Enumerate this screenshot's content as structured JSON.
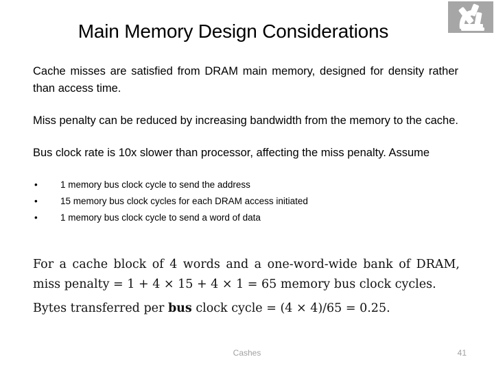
{
  "logo": {
    "icon": "microscope-icon",
    "bg_color": "#a6a6a6",
    "glyph_color": "#ffffff"
  },
  "title": "Main Memory Design Considerations",
  "body": {
    "paragraphs": [
      "Cache misses are satisfied from DRAM main memory, designed for density rather than access time.",
      "Miss penalty can be reduced by increasing bandwidth from the memory to the cache.",
      "Bus clock rate is 10x slower than processor, affecting the miss penalty. Assume"
    ],
    "bullet_char": "•",
    "bullets": [
      "1 memory bus clock cycle to send the address",
      "15 memory bus clock cycles for each DRAM access initiated",
      "1 memory bus clock cycle to send a word of data"
    ]
  },
  "math": {
    "paragraph": "For a cache block of 4 words and a one-word-wide bank of DRAM, miss penalty = 1 + 4 × 15 + 4 × 1 = 65 memory bus clock cycles.",
    "line2_prefix": "Bytes transferred per ",
    "line2_bold": "bus",
    "line2_suffix": " clock cycle = (4 × 4)/65 = 0.25."
  },
  "footer": {
    "center_label": "Cashes",
    "page_number": "41",
    "color": "#a0a0a0"
  }
}
